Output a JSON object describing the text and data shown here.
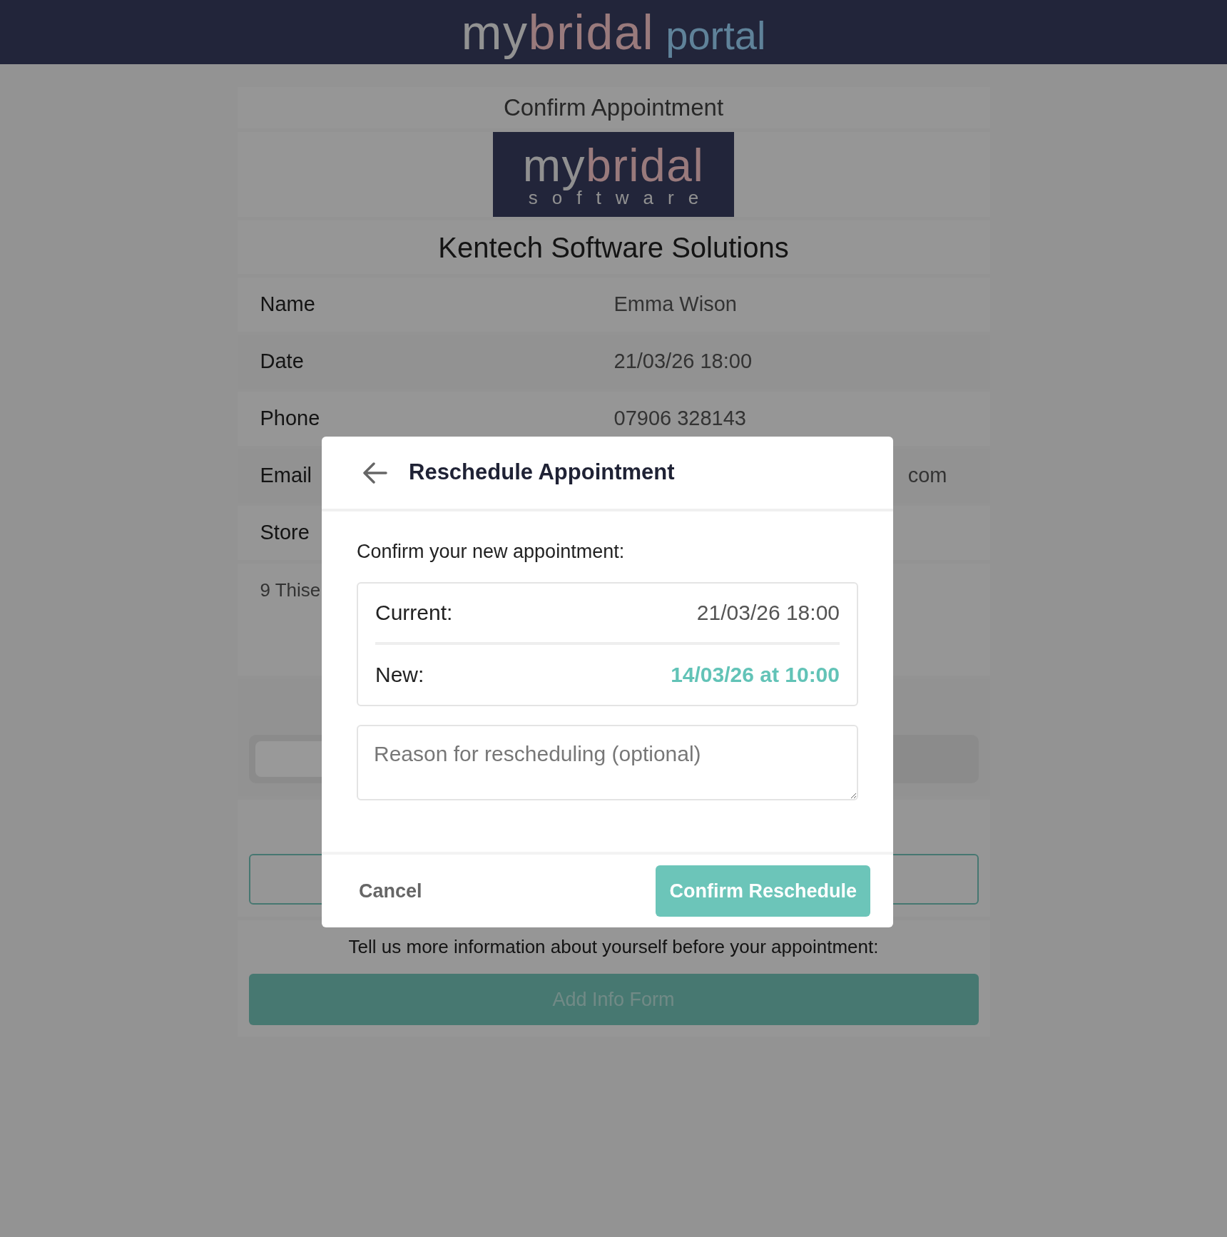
{
  "header": {
    "logo": {
      "my": "my",
      "bridal": "bridal",
      "portal": "portal"
    }
  },
  "page": {
    "title": "Confirm Appointment",
    "logo": {
      "my": "my",
      "bridal": "bridal",
      "tagline": "software"
    },
    "company": "Kentech Software Solutions",
    "details": [
      {
        "label": "Name",
        "value": "Emma Wison",
        "kind": "field"
      },
      {
        "label": "Date",
        "value": "21/03/26 18:00",
        "kind": "field"
      },
      {
        "label": "Phone",
        "value": "07906 328143",
        "kind": "field"
      },
      {
        "label": "Email",
        "value": "com",
        "kind": "cut"
      },
      {
        "label": "Store",
        "kind": "field"
      }
    ],
    "address": "9 Thise",
    "info_prompt": "Tell us more information about yourself before your appointment:",
    "info_button": "Add Info Form"
  },
  "dialog": {
    "title": "Reschedule Appointment",
    "prompt": "Confirm your new appointment:",
    "current": {
      "label": "Current:",
      "value": "21/03/26 18:00"
    },
    "new": {
      "label": "New:",
      "value": "14/03/26 at 10:00"
    },
    "reason": {
      "placeholder": "Reason for rescheduling (optional)"
    },
    "cancel": "Cancel",
    "confirm": "Confirm Reschedule"
  }
}
